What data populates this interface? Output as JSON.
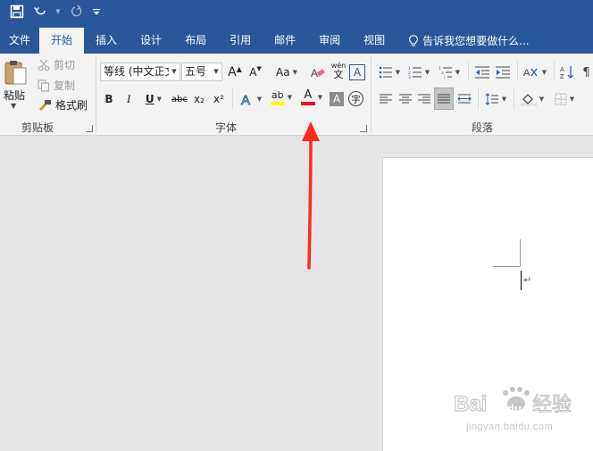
{
  "qat": {
    "save": "save-icon",
    "undo": "undo-icon",
    "redo": "redo-icon"
  },
  "tabs": [
    "文件",
    "开始",
    "插入",
    "设计",
    "布局",
    "引用",
    "邮件",
    "审阅",
    "视图"
  ],
  "tell_me": "告诉我您想要做什么...",
  "clipboard": {
    "paste": "粘贴",
    "cut": "剪切",
    "copy": "复制",
    "format_painter": "格式刷",
    "group_label": "剪贴板"
  },
  "font": {
    "font_name": "等线 (中文正文",
    "font_size": "五号",
    "group_label": "字体",
    "bold": "B",
    "italic": "I",
    "underline": "U",
    "strikethrough": "abc",
    "subscript": "x₂",
    "superscript": "x²",
    "grow": "A",
    "shrink": "A",
    "change_case": "Aa",
    "font_color": "A",
    "highlight": "ab",
    "phonetic": "wén",
    "phonetic_char": "文",
    "border_char": "A",
    "shading_char": "A",
    "enclose_char": "字",
    "font_color_hex": "#e81123",
    "highlight_hex": "#ffff00"
  },
  "paragraph": {
    "group_label": "段落"
  },
  "colors": {
    "brand": "#2b579a",
    "ribbon": "#f3f3f3",
    "arrow": "#ff2a1f"
  },
  "watermark": {
    "text": "jingyan.baidu.com"
  }
}
